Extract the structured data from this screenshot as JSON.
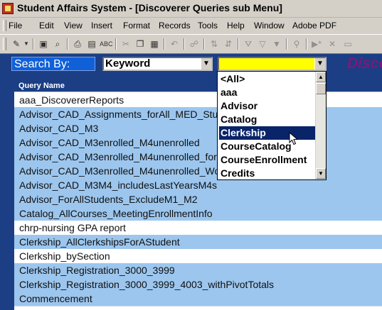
{
  "window": {
    "title": "Student Affairs System - [Discoverer Queries sub Menu]"
  },
  "menu": {
    "items": [
      "File",
      "Edit",
      "View",
      "Insert",
      "Format",
      "Records",
      "Tools",
      "Help",
      "Window",
      "Adobe PDF"
    ]
  },
  "toolbar": {
    "buttons": [
      "design-view-icon",
      "save-icon",
      "search-icon",
      "print-icon",
      "print-preview-icon",
      "spelling-icon",
      "cut-icon",
      "copy-icon",
      "paste-icon",
      "undo-icon",
      "hyperlink-icon",
      "sort-ascending-icon",
      "sort-descending-icon",
      "filter-by-selection-icon",
      "filter-by-form-icon",
      "apply-filter-icon",
      "find-icon",
      "new-record-icon",
      "delete-record-icon"
    ]
  },
  "search": {
    "label": "Search By:",
    "type_value": "Keyword",
    "value": ""
  },
  "form_title": "Disco",
  "list": {
    "header": "Query Name",
    "rows": [
      "aaa_DiscovererReports",
      "Advisor_CAD_Assignments_forAll_MED_Stu",
      "Advisor_CAD_M3",
      "Advisor_CAD_M3enrolled_M4unenrolled",
      "Advisor_CAD_M3enrolled_M4unenrolled_for",
      "Advisor_CAD_M3enrolled_M4unenrolled_Wo",
      "Advisor_CAD_M3M4_includesLastYearsM4s",
      "Advisor_ForAllStudents_ExcludeM1_M2",
      "Catalog_AllCourses_MeetingEnrollmentInfo",
      "chrp-nursing GPA report",
      "Clerkship_AllClerkshipsForAStudent",
      "Clerkship_bySection",
      "Clerkship_Registration_3000_3999",
      "Clerkship_Registration_3000_3999_4003_withPivotTotals",
      "Commencement"
    ]
  },
  "dropdown": {
    "items": [
      "<All>",
      "aaa",
      "Advisor",
      "Catalog",
      "Clerkship",
      "CourseCatalog",
      "CourseEnrollment",
      "Credits"
    ],
    "selected": "Clerkship"
  },
  "colors": {
    "form_background": "#1c3e84",
    "row_shaded": "#9cc6ee",
    "search_value_background": "#ffff00",
    "form_title": "#7a1a7a",
    "selection": "#0a246a"
  }
}
